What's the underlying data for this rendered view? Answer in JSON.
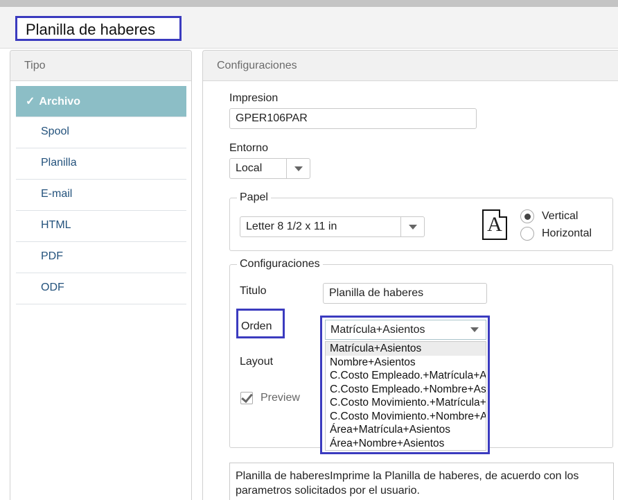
{
  "header": {
    "title": "Planilla de haberes"
  },
  "tipo": {
    "heading": "Tipo",
    "items": [
      {
        "label": "Archivo",
        "check": "✓"
      },
      {
        "label": "Spool"
      },
      {
        "label": "Planilla"
      },
      {
        "label": "E-mail"
      },
      {
        "label": "HTML"
      },
      {
        "label": "PDF"
      },
      {
        "label": "ODF"
      }
    ]
  },
  "config": {
    "heading": "Configuraciones",
    "impresion": {
      "label": "Impresion",
      "value": "GPER106PAR"
    },
    "entorno": {
      "label": "Entorno",
      "value": "Local"
    },
    "papel": {
      "legend": "Papel",
      "size": "Letter 8 1/2 x 11 in",
      "icon_letter": "A",
      "orientation": {
        "vertical": "Vertical",
        "horizontal": "Horizontal",
        "selected": "Vertical"
      }
    },
    "settings": {
      "legend": "Configuraciones",
      "titulo": {
        "label": "Titulo",
        "value": "Planilla de haberes"
      },
      "orden": {
        "label": "Orden",
        "value": "Matrícula+Asientos",
        "options": [
          "Matrícula+Asientos",
          "Nombre+Asientos",
          "C.Costo Empleado.+Matrícula+Asientos",
          "C.Costo Empleado.+Nombre+Asientos",
          "C.Costo Movimiento.+Matrícula+Asientos",
          "C.Costo Movimiento.+Nombre+Asientos",
          "Área+Matrícula+Asientos",
          "Área+Nombre+Asientos"
        ]
      },
      "layout": {
        "label": "Layout"
      },
      "preview": {
        "label": "Preview",
        "checked": true
      }
    },
    "description": "Planilla de haberesImprime la Planilla de haberes, de acuerdo con los parametros solicitados por el usuario."
  },
  "colors": {
    "accent": "#8cbec6",
    "highlight_border": "#3b3bbf",
    "link": "#23527c"
  },
  "icons": {
    "active_check": "check-icon",
    "dropdown": "chevron-down-icon",
    "paper": "document-icon"
  }
}
